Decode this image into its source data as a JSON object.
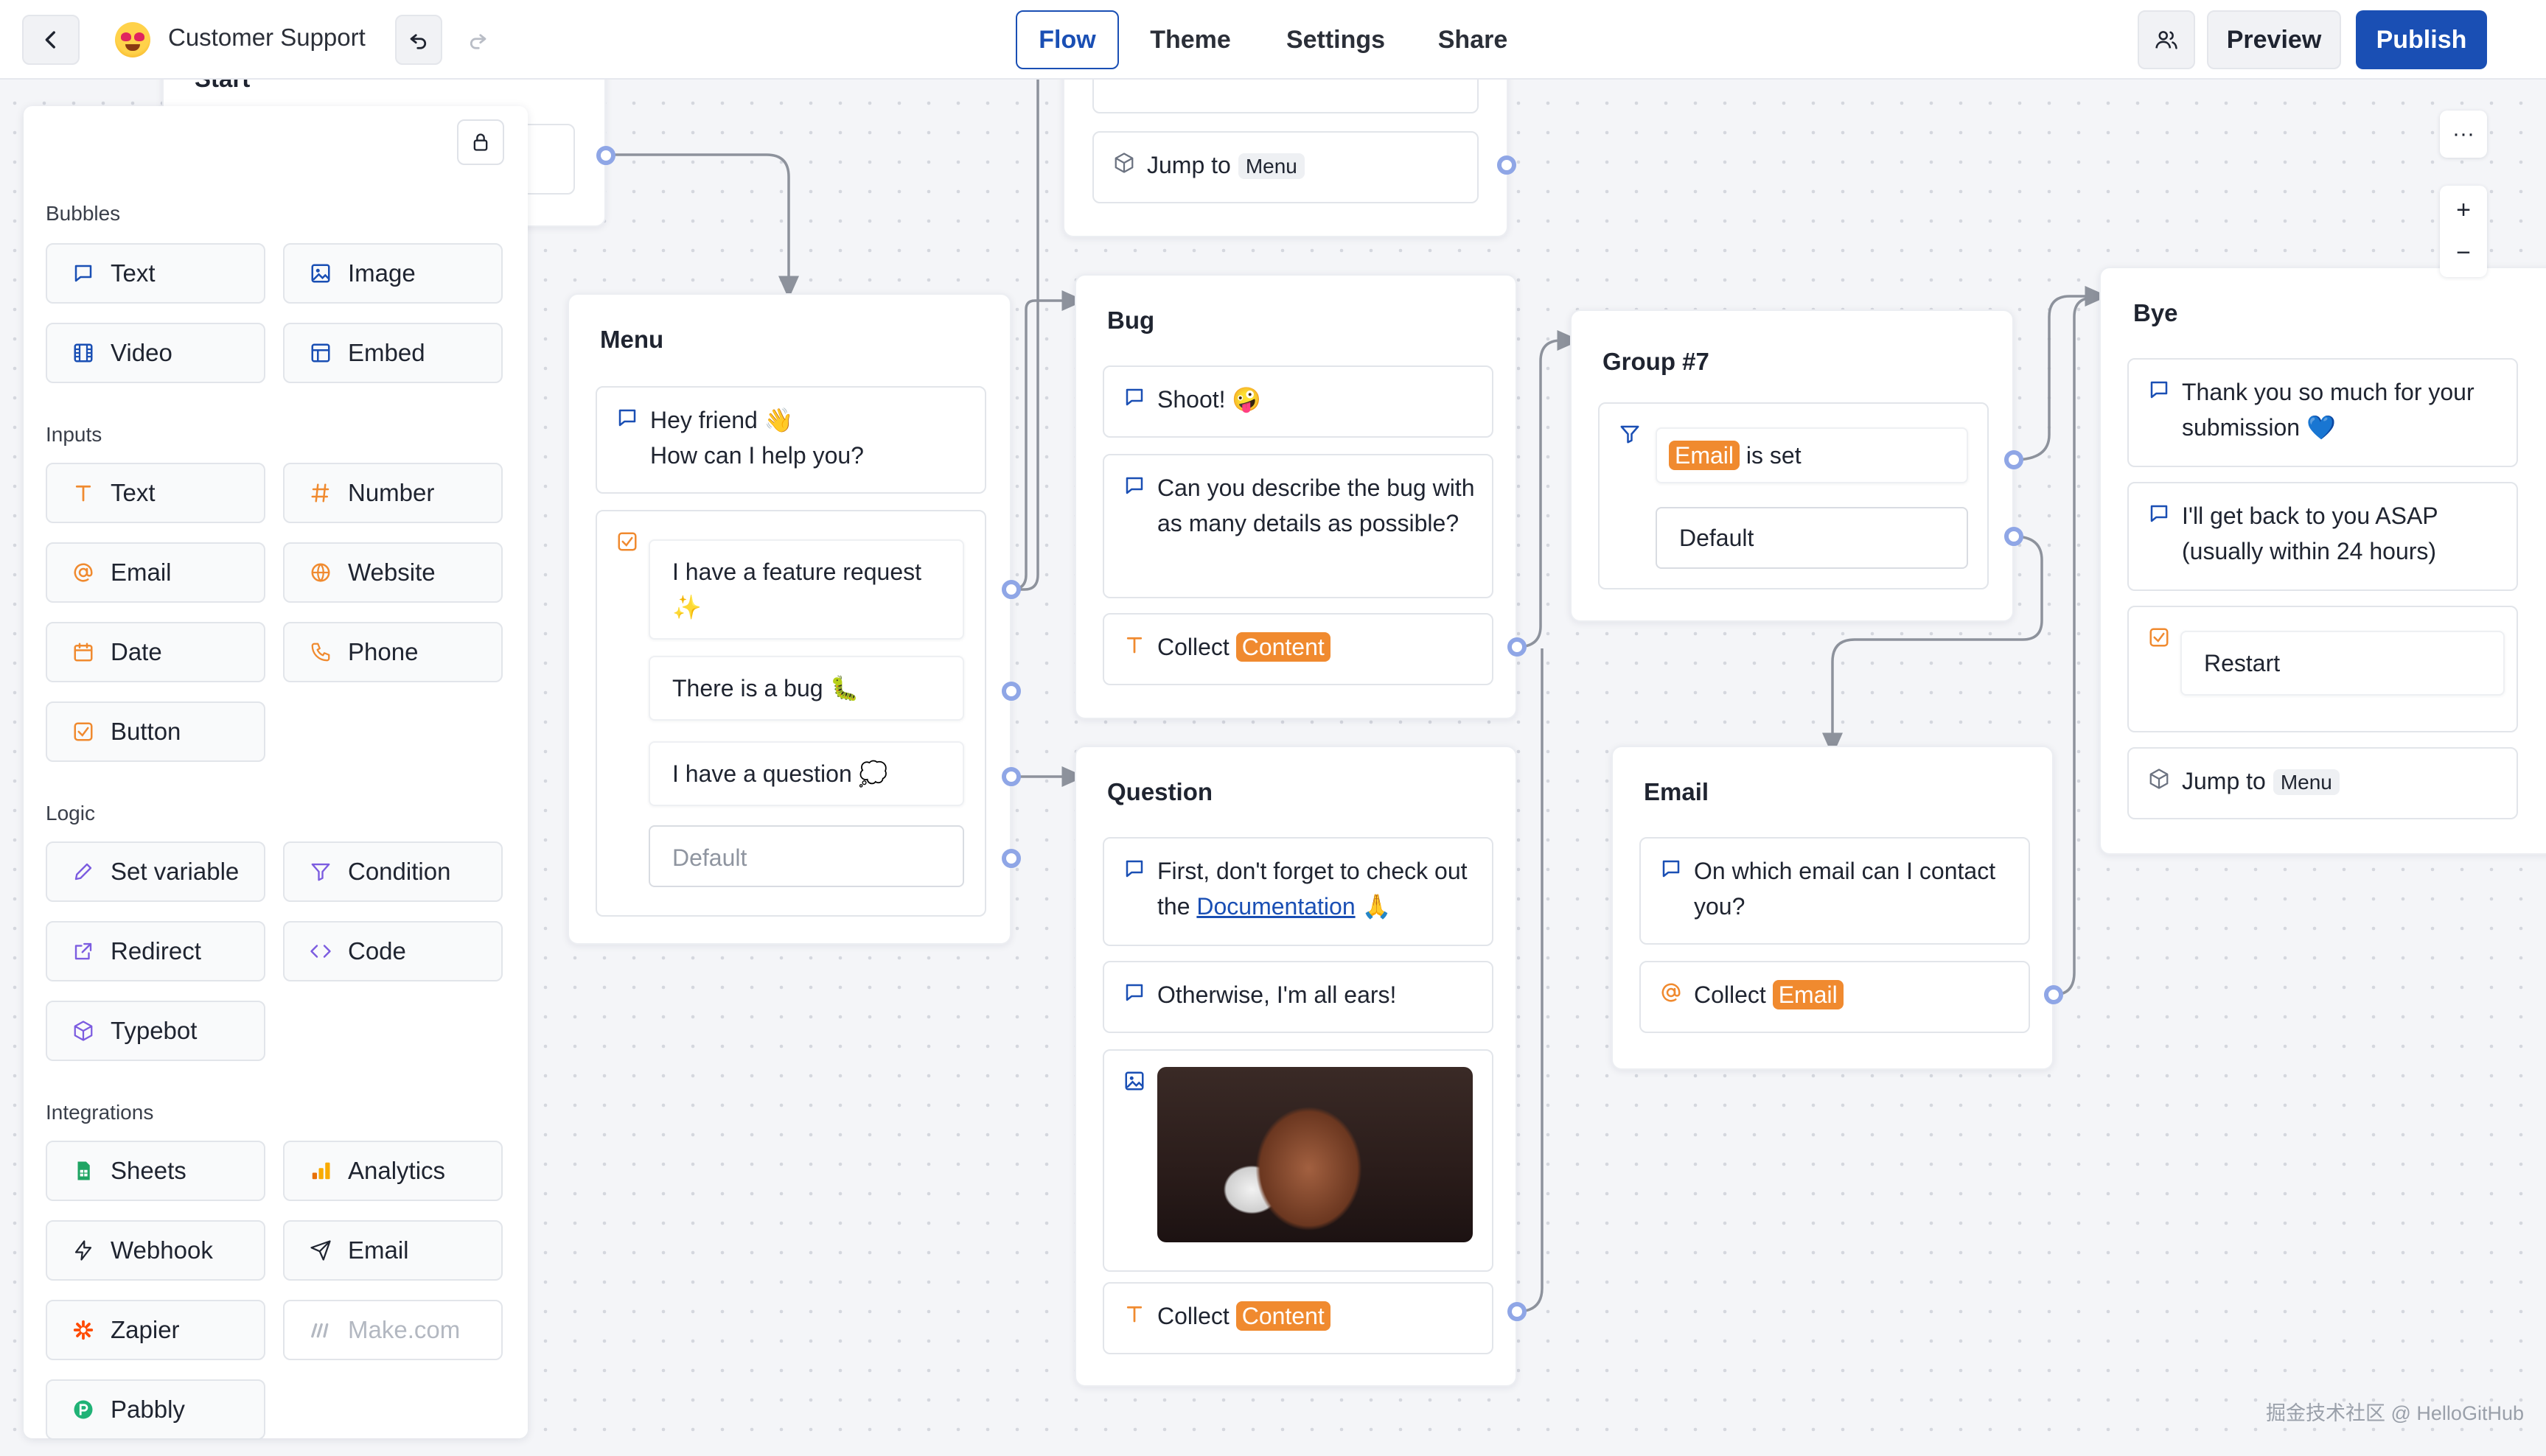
{
  "topbar": {
    "title": "Customer Support",
    "tabs": [
      "Flow",
      "Theme",
      "Settings",
      "Share"
    ],
    "preview": "Preview",
    "publish": "Publish"
  },
  "sidebar": {
    "bubbles_title": "Bubbles",
    "bubbles": [
      "Text",
      "Image",
      "Video",
      "Embed"
    ],
    "inputs_title": "Inputs",
    "inputs": [
      "Text",
      "Number",
      "Email",
      "Website",
      "Date",
      "Phone",
      "Button"
    ],
    "logic_title": "Logic",
    "logic": [
      "Set variable",
      "Condition",
      "Redirect",
      "Code",
      "Typebot"
    ],
    "integrations_title": "Integrations",
    "integrations": [
      "Sheets",
      "Analytics",
      "Webhook",
      "Email",
      "Zapier",
      "Make.com",
      "Pabbly"
    ]
  },
  "start": {
    "title": "Start"
  },
  "top_group": {
    "jump_label": "Jump to",
    "jump_target": "Menu"
  },
  "menu": {
    "title": "Menu",
    "greeting_line1": "Hey friend 👋",
    "greeting_line2": "How can I help you?",
    "choices": [
      "I have a feature request ✨",
      "There is a bug 🐛",
      "I have a question 💭"
    ],
    "default": "Default"
  },
  "bug": {
    "title": "Bug",
    "msg1": "Shoot! 🤪",
    "msg2": "Can you describe the bug with as many details as possible?",
    "collect_label": "Collect",
    "collect_var": "Content"
  },
  "question": {
    "title": "Question",
    "msg1_pre": "First, don't forget to check out the ",
    "msg1_link": "Documentation",
    "msg1_post": " 🙏",
    "msg2": "Otherwise, I'm all ears!",
    "collect_label": "Collect",
    "collect_var": "Content"
  },
  "group7": {
    "title": "Group #7",
    "condition_var": "Email",
    "condition_text": "is set",
    "default": "Default"
  },
  "email_group": {
    "title": "Email",
    "msg1": "On which email can I contact you?",
    "collect_label": "Collect",
    "collect_var": "Email"
  },
  "bye": {
    "title": "Bye",
    "msg1": "Thank you so much for your submission 💙",
    "msg2": "I'll get back to you ASAP (usually within 24 hours)",
    "restart": "Restart",
    "jump_label": "Jump to",
    "jump_target": "Menu"
  },
  "canvas_controls": {
    "more": "···",
    "zoom_in": "+",
    "zoom_out": "−"
  },
  "watermark": "掘金技术社区 @ HelloGitHub",
  "colors": {
    "accent": "#1a4fb4",
    "orange": "#f08a2f",
    "port": "#8fa6e6"
  }
}
